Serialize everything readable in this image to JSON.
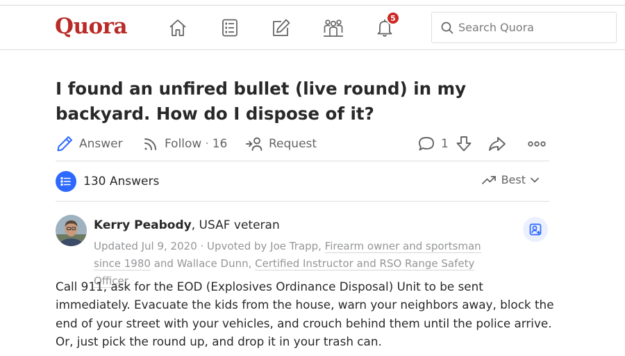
{
  "header": {
    "logo": "Quora",
    "notification_count": "5",
    "search_placeholder": "Search Quora",
    "accent_color": "#b92b27"
  },
  "question": {
    "title": "I found an unfired bullet (live round) in my backyard. How do I dispose of it?"
  },
  "actions": {
    "answer_label": "Answer",
    "follow_label": "Follow",
    "follow_count": "16",
    "request_label": "Request",
    "comment_count": "1"
  },
  "answers_header": {
    "count_label": "130 Answers",
    "sort_label": "Best"
  },
  "answer": {
    "author_name": "Kerry Peabody",
    "author_credential": ", USAF veteran",
    "meta_prefix": "Updated Jul 9, 2020 · Upvoted by Joe Trapp, ",
    "upvoter1_credential": "Firearm owner and sportsman since 1980",
    "meta_and": " and Wallace Dunn, ",
    "upvoter2_credential": "Certified Instructor and RSO Range Safety Officer",
    "text": "Call 911, ask for the EOD (Explosives Ordinance Disposal) Unit to be sent immediately. Evacuate the kids from the house, warn your neighbors away, block the end of your street with your vehicles, and crouch behind them until the police arrive. Or, just pick the round up, and drop it in your trash can."
  }
}
